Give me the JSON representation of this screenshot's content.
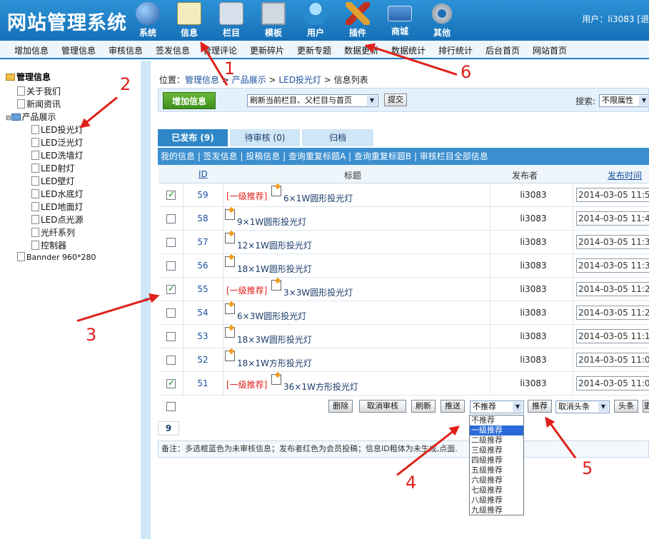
{
  "app": {
    "logo_text": "网站管理系统",
    "user_label": "用户：li3083 [退"
  },
  "top_nav": [
    {
      "label": "系统",
      "icon": "globe-icon",
      "color": "#2a5fa8"
    },
    {
      "label": "信息",
      "icon": "notepad-icon",
      "color": "#e9e2b0"
    },
    {
      "label": "栏目",
      "icon": "folder-icon",
      "color": "#cfd8e4"
    },
    {
      "label": "模板",
      "icon": "window-icon",
      "color": "#c8d4dc"
    },
    {
      "label": "用户",
      "icon": "user-icon",
      "color": "#3aa0d8"
    },
    {
      "label": "插件",
      "icon": "tools-icon",
      "color": "#e0a030"
    },
    {
      "label": "商城",
      "icon": "card-icon",
      "color": "#3a78c0"
    },
    {
      "label": "其他",
      "icon": "gear-icon",
      "color": "#b0b8c0"
    }
  ],
  "menu": [
    "增加信息",
    "管理信息",
    "审核信息",
    "签发信息",
    "管理评论",
    "更新碎片",
    "更新专题",
    "数据更新",
    "数据统计",
    "排行统计",
    "后台首页",
    "网站首页"
  ],
  "tree": {
    "root": "管理信息",
    "items": [
      "关于我们",
      "新闻资讯",
      "产品展示",
      "LED投光灯",
      "LED泛光灯",
      "LED洗墙灯",
      "LED射灯",
      "LED壁灯",
      "LED水底灯",
      "LED地面灯",
      "LED点光源",
      "光纤系列",
      "控制器",
      "Bannder 960*280"
    ]
  },
  "breadcrumb": {
    "prefix": "位置：",
    "p1": "管理信息",
    "sep": " > ",
    "p2": "产品展示",
    "p3": "LED投光灯",
    "p4": "信息列表"
  },
  "action": {
    "add_label": "增加信息",
    "refresh_select": "刷新当前栏目、父栏目与首页",
    "submit": "提交",
    "search_label": "搜索:",
    "search_select": "不限属性"
  },
  "tabs": [
    "已发布 (9)",
    "待审核 (0)",
    "归档"
  ],
  "links_bar": "我的信息 | 签发信息 | 投稿信息 | 查询重复标题A | 查询重复标题B | 审核栏目全部信息",
  "columns": {
    "id": "ID",
    "title": "标题",
    "publisher": "发布者",
    "time": "发布时间"
  },
  "rows": [
    {
      "checked": true,
      "id": "59",
      "tag": "[一级推荐]",
      "title": "6×1W圆形投光灯",
      "publisher": "li3083",
      "time": "2014-03-05 11:5"
    },
    {
      "checked": false,
      "id": "58",
      "tag": "",
      "title": "9×1W圆形投光灯",
      "publisher": "li3083",
      "time": "2014-03-05 11:4"
    },
    {
      "checked": false,
      "id": "57",
      "tag": "",
      "title": "12×1W圆形投光灯",
      "publisher": "li3083",
      "time": "2014-03-05 11:3"
    },
    {
      "checked": false,
      "id": "56",
      "tag": "",
      "title": "18×1W圆形投光灯",
      "publisher": "li3083",
      "time": "2014-03-05 11:3"
    },
    {
      "checked": true,
      "id": "55",
      "tag": "[一级推荐]",
      "title": "3×3W圆形投光灯",
      "publisher": "li3083",
      "time": "2014-03-05 11:2"
    },
    {
      "checked": false,
      "id": "54",
      "tag": "",
      "title": "6×3W圆形投光灯",
      "publisher": "li3083",
      "time": "2014-03-05 11:2"
    },
    {
      "checked": false,
      "id": "53",
      "tag": "",
      "title": "18×3W圆形投光灯",
      "publisher": "li3083",
      "time": "2014-03-05 11:1"
    },
    {
      "checked": false,
      "id": "52",
      "tag": "",
      "title": "18×1W方形投光灯",
      "publisher": "li3083",
      "time": "2014-03-05 11:0"
    },
    {
      "checked": true,
      "id": "51",
      "tag": "[一级推荐]",
      "title": "36×1W方形投光灯",
      "publisher": "li3083",
      "time": "2014-03-05 11:0"
    }
  ],
  "bottom": {
    "delete": "删除",
    "unaudit": "取消审核",
    "refresh": "刷新",
    "push": "推送",
    "rec_select": "不推荐",
    "recommend": "推荐",
    "head_select": "取消头条",
    "headline": "头条",
    "more": "更"
  },
  "page_num": "9",
  "note": "备注：多选框蓝色为未审核信息；发布者红色为会员投稿；信息ID粗体为未生成,点",
  "note_tail": "面.",
  "dropdown_options": [
    "不推荐",
    "一级推荐",
    "二级推荐",
    "三级推荐",
    "四级推荐",
    "五级推荐",
    "六级推荐",
    "七级推荐",
    "八级推荐",
    "九级推荐"
  ],
  "annotations": [
    "1",
    "2",
    "3",
    "4",
    "5",
    "6"
  ],
  "colors": {
    "header_blue": "#1f7fc4",
    "annotation_red": "#e0201a",
    "recommend_red": "#e0201a",
    "add_green": "#4a9e26"
  }
}
